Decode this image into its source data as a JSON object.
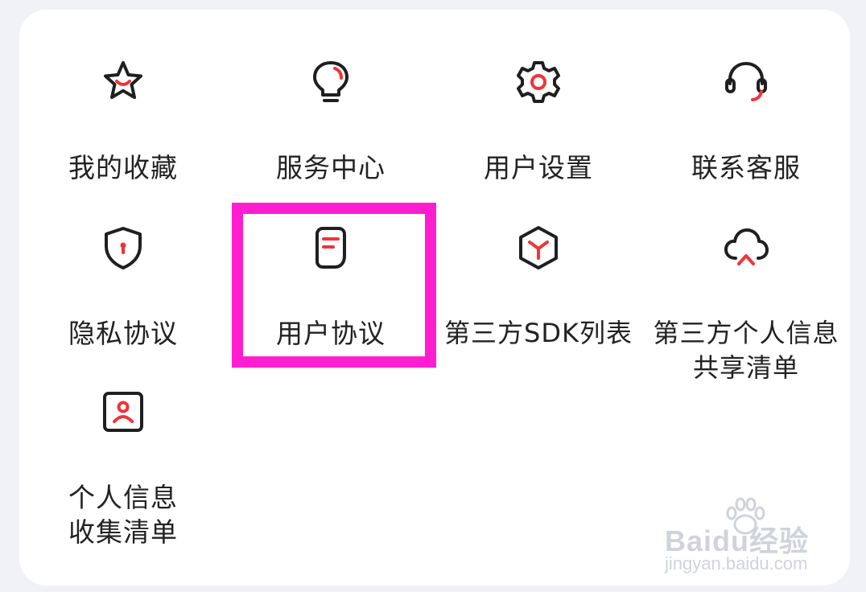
{
  "menu": {
    "items": [
      {
        "label": "我的收藏",
        "icon": "star-icon"
      },
      {
        "label": "服务中心",
        "icon": "lightbulb-icon"
      },
      {
        "label": "用户设置",
        "icon": "gear-icon"
      },
      {
        "label": "联系客服",
        "icon": "headset-icon"
      },
      {
        "label": "隐私协议",
        "icon": "shield-icon"
      },
      {
        "label": "用户协议",
        "icon": "document-icon"
      },
      {
        "label": "第三方SDK列表",
        "icon": "cube-icon"
      },
      {
        "label": "第三方个人信息共享清单",
        "icon": "cloud-icon"
      },
      {
        "label": "个人信息收集清单",
        "icon": "person-card-icon"
      }
    ]
  },
  "watermark": {
    "brand": "Baidu经验",
    "url": "jingyan.baidu.com"
  },
  "colors": {
    "accent": "#f0343a",
    "icon_stroke": "#1f1f1f",
    "highlight": "#ff1ecf",
    "card_background": "#ffffff",
    "page_background": "#f1f2f6"
  }
}
